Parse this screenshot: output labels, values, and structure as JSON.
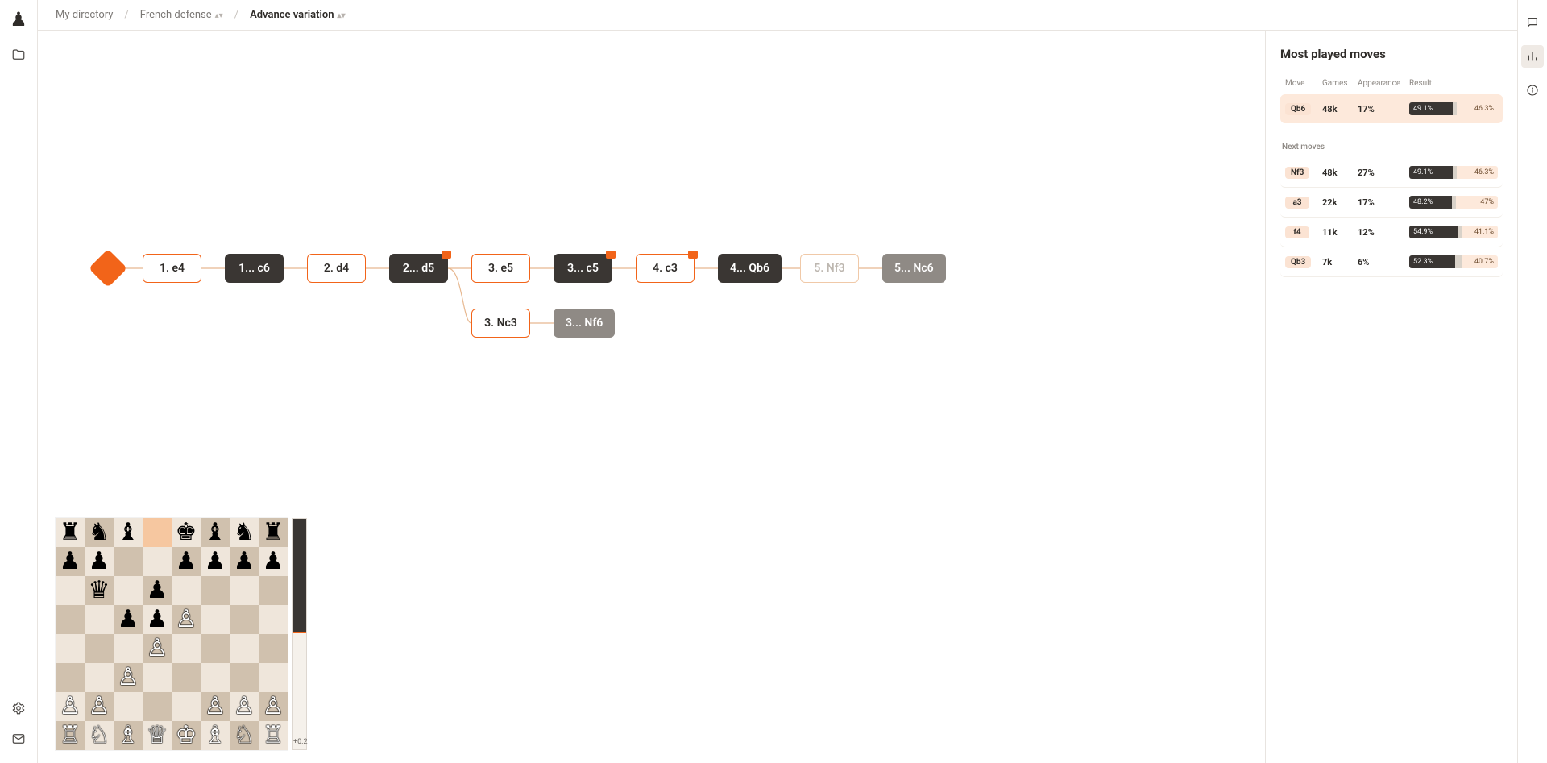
{
  "breadcrumbs": {
    "root": "My directory",
    "parent": "French defense",
    "current": "Advance variation"
  },
  "tree": {
    "main": [
      {
        "id": "m1",
        "label": "1. e4",
        "side": "white",
        "badge": false
      },
      {
        "id": "m2",
        "label": "1... c6",
        "side": "black",
        "badge": false
      },
      {
        "id": "m3",
        "label": "2. d4",
        "side": "white",
        "badge": false
      },
      {
        "id": "m4",
        "label": "2... d5",
        "side": "black",
        "badge": true
      },
      {
        "id": "m5",
        "label": "3. e5",
        "side": "white",
        "badge": false
      },
      {
        "id": "m6",
        "label": "3... c5",
        "side": "black",
        "badge": true
      },
      {
        "id": "m7",
        "label": "4. c3",
        "side": "white",
        "badge": true
      },
      {
        "id": "m8",
        "label": "4... Qb6",
        "side": "black",
        "badge": false
      },
      {
        "id": "m9",
        "label": "5. Nf3",
        "side": "ghost",
        "badge": false
      },
      {
        "id": "m10",
        "label": "5... Nc6",
        "side": "grey",
        "badge": false
      }
    ],
    "branch": [
      {
        "id": "b1",
        "label": "3. Nc3",
        "side": "white",
        "badge": false
      },
      {
        "id": "b2",
        "label": "3... Nf6",
        "side": "grey",
        "badge": false
      }
    ]
  },
  "board": {
    "rows": [
      [
        "r",
        "n",
        "b",
        "",
        "k",
        "b",
        "n",
        "r"
      ],
      [
        "p",
        "p",
        "",
        "",
        "p",
        "p",
        "p",
        "p"
      ],
      [
        "",
        "q",
        "",
        "p",
        "",
        "",
        "",
        ""
      ],
      [
        "",
        "",
        "p",
        "p",
        "P",
        "",
        "",
        ""
      ],
      [
        "",
        "",
        "",
        "P",
        "",
        "",
        "",
        ""
      ],
      [
        "",
        "",
        "P",
        "",
        "",
        "",
        "",
        ""
      ],
      [
        "P",
        "P",
        "",
        "",
        "",
        "P",
        "P",
        "P"
      ],
      [
        "R",
        "N",
        "B",
        "Q",
        "K",
        "B",
        "N",
        "R"
      ]
    ],
    "highlight": [
      {
        "r": 0,
        "c": 3
      }
    ],
    "eval_label": "+0.2",
    "eval_black_pct": 49
  },
  "sidebar": {
    "title": "Most played moves",
    "headers": {
      "move": "Move",
      "games": "Games",
      "appearance": "Appearance",
      "result": "Result"
    },
    "featured": {
      "move": "Qb6",
      "games": "48k",
      "appearance": "17%",
      "white": "49.1%",
      "black": "46.3%",
      "w_pct": 49,
      "d_pct": 5,
      "b_pct": 46
    },
    "next_label": "Next moves",
    "next": [
      {
        "move": "Nf3",
        "games": "48k",
        "appearance": "27%",
        "white": "49.1%",
        "black": "46.3%",
        "w_pct": 49,
        "d_pct": 5,
        "b_pct": 46
      },
      {
        "move": "a3",
        "games": "22k",
        "appearance": "17%",
        "white": "48.2%",
        "black": "47%",
        "w_pct": 48,
        "d_pct": 5,
        "b_pct": 47
      },
      {
        "move": "f4",
        "games": "11k",
        "appearance": "12%",
        "white": "54.9%",
        "black": "41.1%",
        "w_pct": 55,
        "d_pct": 4,
        "b_pct": 41
      },
      {
        "move": "Qb3",
        "games": "7k",
        "appearance": "6%",
        "white": "52.3%",
        "black": "40.7%",
        "w_pct": 52,
        "d_pct": 7,
        "b_pct": 41
      }
    ]
  }
}
